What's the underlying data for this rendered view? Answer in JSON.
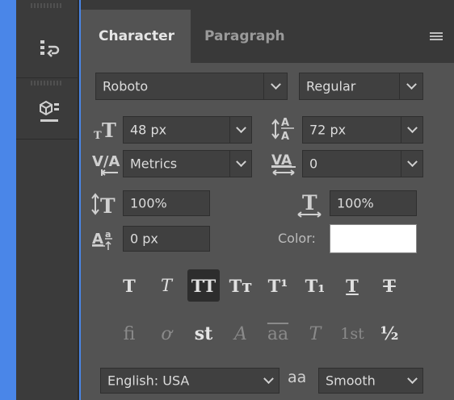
{
  "panel": {
    "tabs": [
      {
        "label": "Character",
        "active": true
      },
      {
        "label": "Paragraph",
        "active": false
      }
    ]
  },
  "character": {
    "font_family": "Roboto",
    "font_style": "Regular",
    "font_size": "48 px",
    "leading": "72 px",
    "kerning": "Metrics",
    "tracking": "0",
    "vertical_scale": "100%",
    "horizontal_scale": "100%",
    "baseline_shift": "0 px",
    "color_label": "Color:",
    "color_value": "#ffffff"
  },
  "format_buttons": [
    {
      "name": "faux-bold-button",
      "glyph": "T",
      "active": false
    },
    {
      "name": "faux-italic-button",
      "glyph": "T",
      "active": false
    },
    {
      "name": "all-caps-button",
      "glyph": "TT",
      "active": true
    },
    {
      "name": "small-caps-button",
      "glyph": "Tт",
      "active": false
    },
    {
      "name": "superscript-button",
      "glyph": "T¹",
      "active": false
    },
    {
      "name": "subscript-button",
      "glyph": "T₁",
      "active": false
    },
    {
      "name": "underline-button",
      "glyph": "T",
      "active": false
    },
    {
      "name": "strikethrough-button",
      "glyph": "T",
      "active": false
    }
  ],
  "opentype_buttons": [
    {
      "name": "ligatures-button",
      "glyph": "fi",
      "on": false
    },
    {
      "name": "discretionary-ligatures-button",
      "glyph": "ơ",
      "on": false
    },
    {
      "name": "stylistic-alternates-st-button",
      "glyph": "st",
      "on": true
    },
    {
      "name": "swash-button",
      "glyph": "A",
      "on": false
    },
    {
      "name": "titling-alternates-button",
      "glyph": "aa",
      "on": false
    },
    {
      "name": "stylistic-alternates-button",
      "glyph": "T",
      "on": false
    },
    {
      "name": "ordinals-button",
      "glyph": "1st",
      "on": false
    },
    {
      "name": "fractions-button",
      "glyph": "½",
      "on": true
    }
  ],
  "bottom": {
    "language": "English: USA",
    "aa_label": "aa",
    "antialias": "Smooth"
  }
}
